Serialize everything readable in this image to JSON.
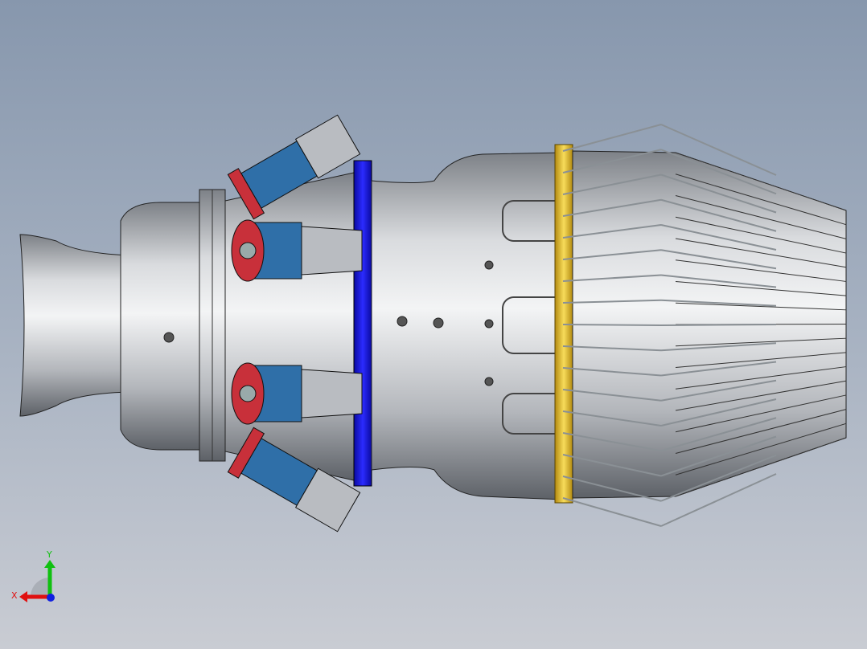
{
  "viewport": {
    "background_top": "#8797ad",
    "background_bottom": "#c9ccd3"
  },
  "model": {
    "body_color": "#b9bcc1",
    "ring_blue": "#1a1ae6",
    "ring_yellow": "#e8c22a",
    "injector_blue": "#2f6fa8",
    "injector_red": "#c8303a"
  },
  "triad": {
    "x_label": "X",
    "y_label": "Y",
    "x_color": "#e01010",
    "y_color": "#10c010",
    "z_color": "#1020e0"
  }
}
